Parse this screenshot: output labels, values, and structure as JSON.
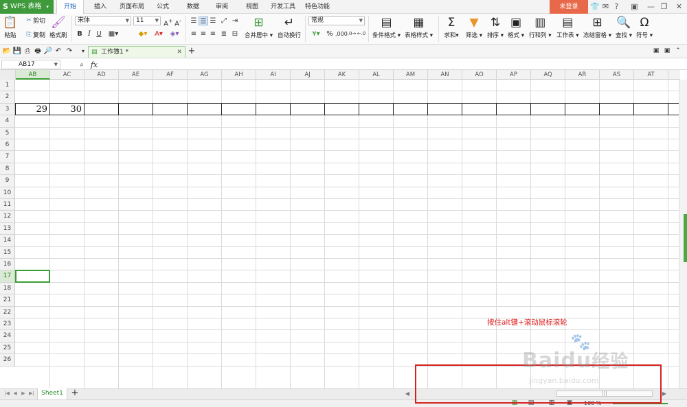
{
  "app": {
    "name": "WPS 表格",
    "login": "未登录"
  },
  "menu": {
    "items": [
      "开始",
      "插入",
      "页面布局",
      "公式",
      "数据",
      "审阅",
      "视图",
      "开发工具",
      "特色功能"
    ],
    "active": "开始"
  },
  "ribbon": {
    "paste": "粘贴",
    "cut": "剪切",
    "copy": "复制",
    "format_painter": "格式刷",
    "font_name": "宋体",
    "font_size": "11",
    "bold": "B",
    "italic": "I",
    "underline": "U",
    "merge": "合并居中",
    "wrap": "自动换行",
    "number_format": "常规",
    "percent": "%",
    "cond_format": "条件格式",
    "table_style": "表格样式",
    "sum": "求和",
    "filter": "筛选",
    "sort": "排序",
    "format": "格式",
    "rowcol": "行和列",
    "worksheet": "工作表",
    "freeze": "冻结窗格",
    "find": "查找",
    "symbol": "符号"
  },
  "doc_tab": "工作簿1 *",
  "formula": {
    "name_box": "AB17",
    "fx": "fx",
    "value": ""
  },
  "columns": [
    "AB",
    "AC",
    "AD",
    "AE",
    "AF",
    "AG",
    "AH",
    "AI",
    "AJ",
    "AK",
    "AL",
    "AM",
    "AN",
    "AO",
    "AP",
    "AQ",
    "AR",
    "AS",
    "AT"
  ],
  "selected_column": "AB",
  "rows": [
    "1",
    "2",
    "3",
    "4",
    "5",
    "6",
    "7",
    "8",
    "9",
    "10",
    "11",
    "12",
    "13",
    "14",
    "15",
    "16",
    "17",
    "18",
    "21",
    "22",
    "23",
    "24",
    "25",
    "26"
  ],
  "selected_row": "17",
  "cells": {
    "ab3": "29",
    "ac3": "30"
  },
  "sheet_tab": "Sheet1",
  "zoom": "100 %",
  "annotation": "按住alt键+滚动鼠标滚轮",
  "watermark": {
    "brand": "Baidu",
    "brand_cn": "经验",
    "url": "jingyan.baidu.com"
  },
  "colors": {
    "brand_green": "#3e9a3b",
    "login_orange": "#e8694a",
    "annotation_red": "#e11d1d"
  }
}
